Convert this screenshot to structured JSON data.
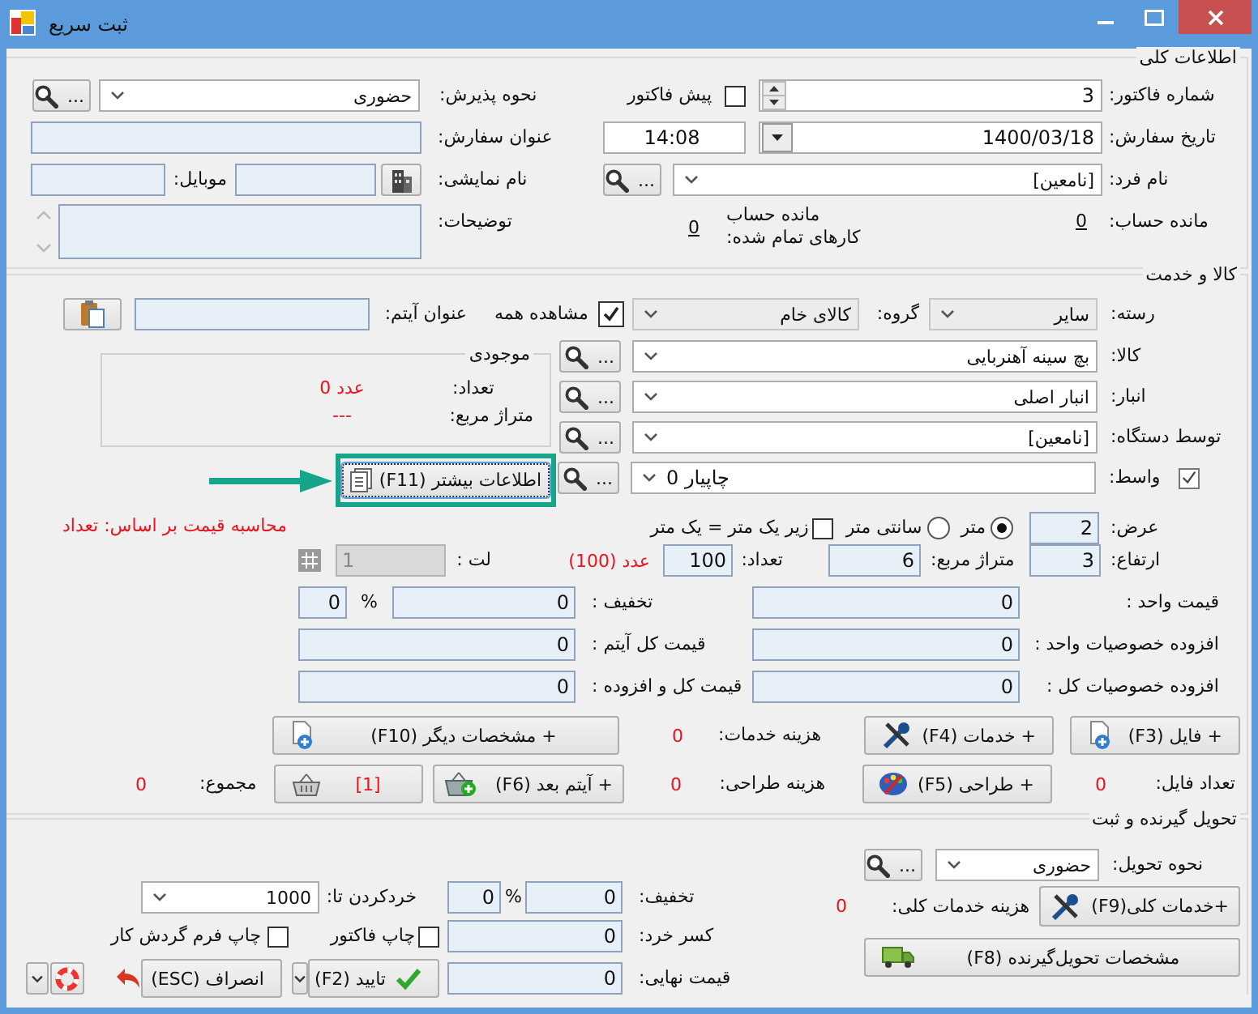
{
  "window": {
    "title": "ثبت سریع"
  },
  "general": {
    "legend": "اطلاعات کلی",
    "invoice_number": {
      "label": "شماره فاکتور:",
      "value": "3"
    },
    "pre_invoice": {
      "label": "پیش فاکتور",
      "checked": false
    },
    "reception": {
      "label": "نحوه پذیرش:",
      "value": "حضوری",
      "button": "..."
    },
    "order_date": {
      "label": "تاریخ سفارش:",
      "value": "1400/03/18",
      "time": "14:08"
    },
    "order_title": {
      "label": "عنوان سفارش:"
    },
    "person": {
      "label": "نام فرد:",
      "value": "[نامعین]",
      "button": "..."
    },
    "display_name": {
      "label": "نام نمایشی:"
    },
    "mobile": {
      "label": "موبایل:"
    },
    "balance": {
      "label": "مانده حساب:",
      "value": "0"
    },
    "balance_done": {
      "label_1": "مانده حساب",
      "label_2": "کارهای تمام شده:",
      "value": "0"
    },
    "notes": {
      "label": "توضیحات:"
    }
  },
  "goods": {
    "legend": "کالا و خدمت",
    "category": {
      "label": "رسته:",
      "value": "سایر"
    },
    "group": {
      "label": "گروه:",
      "value": "کالای خام"
    },
    "show_all": {
      "label": "مشاهده همه",
      "checked": true
    },
    "item_title": {
      "label": "عنوان آیتم:"
    },
    "lookups": [
      {
        "label": "کالا:",
        "value": "بچ سینه آهنربایی",
        "button": "..."
      },
      {
        "label": "انبار:",
        "value": "انبار اصلی",
        "button": "..."
      },
      {
        "label": "توسط دستگاه:",
        "value": "[نامعین]",
        "button": "..."
      }
    ],
    "broker": {
      "label": "واسط:",
      "checked": true,
      "value": "چاپیار 0",
      "button": "..."
    },
    "stock": {
      "legend": "موجودی",
      "count_label": "تعداد:",
      "count": "عدد 0",
      "area_label": "متراژ مربع:",
      "area": "---"
    },
    "more_info": {
      "label": "اطلاعات بیشتر (F11)",
      "highlighted": true
    },
    "pricing_basis": "محاسبه قیمت بر اساس: تعداد",
    "width": {
      "label": "عرض:",
      "value": "2"
    },
    "units": [
      {
        "label": "متر",
        "selected": true
      },
      {
        "label": "سانتی متر",
        "selected": false
      }
    ],
    "under_meter": {
      "label": "زیر یک متر = یک متر",
      "checked": false
    },
    "height": {
      "label": "ارتفاع:",
      "value": "3"
    },
    "area": {
      "label": "متراژ مربع:",
      "value": "6"
    },
    "quantity": {
      "label": "تعداد:",
      "value": "100",
      "note": "عدد (100)"
    },
    "leaf": {
      "label": "لت :",
      "value": "1",
      "disabled": true
    },
    "unit_price": {
      "label": "قیمت واحد :",
      "value": "0"
    },
    "discount": {
      "label": "تخفیف :",
      "value": "0",
      "percent_sign": "%",
      "percent": "0"
    },
    "unit_extras": {
      "label": "افزوده خصوصیات واحد :",
      "value": "0"
    },
    "item_total": {
      "label": "قیمت کل آیتم :",
      "value": "0"
    },
    "total_extras": {
      "label": "افزوده خصوصیات کل :",
      "value": "0"
    },
    "total_with_extras": {
      "label": "قیمت کل و افزوده :",
      "value": "0"
    },
    "file_button": "+ فایل (F3)",
    "services_button": "+ خدمات (F4)",
    "services_cost": {
      "label": "هزینه خدمات:",
      "value": "0"
    },
    "other_specs_button": "+ مشخصات دیگر (F10)",
    "file_count": {
      "label": "تعداد فایل:",
      "value": "0"
    },
    "design_button": "+ طراحی (F5)",
    "design_cost": {
      "label": "هزینه طراحی:",
      "value": "0"
    },
    "next_item_button": "+ آیتم بعد (F6)",
    "basket_button": "[1]",
    "sum": {
      "label": "مجموع:",
      "value": "0"
    }
  },
  "delivery": {
    "legend": "تحویل گیرنده و ثبت",
    "method": {
      "label": "نحوه تحویل:",
      "value": "حضوری",
      "button": "..."
    },
    "discount": {
      "label": "تخفیف:",
      "value": "0",
      "percent_sign": "%",
      "percent": "0"
    },
    "rounding": {
      "label": "خردکردن تا:",
      "value": "1000"
    },
    "rounding_off": {
      "label": "کسر خرد:",
      "value": "0"
    },
    "final_price": {
      "label": "قیمت نهایی:",
      "value": "0"
    },
    "print_invoice": {
      "label": "چاپ فاکتور",
      "checked": false
    },
    "print_workflow": {
      "label": "چاپ فرم گردش کار",
      "checked": false
    },
    "services_cost": {
      "label": "هزینه خدمات کلی:",
      "value": "0"
    },
    "services_button": "+خدمات کلی(F9)",
    "recipient_button": "مشخصات تحویل‌گیرنده (F8)",
    "confirm_button": "تایید (F2)",
    "cancel_button": "انصراف (ESC)"
  }
}
